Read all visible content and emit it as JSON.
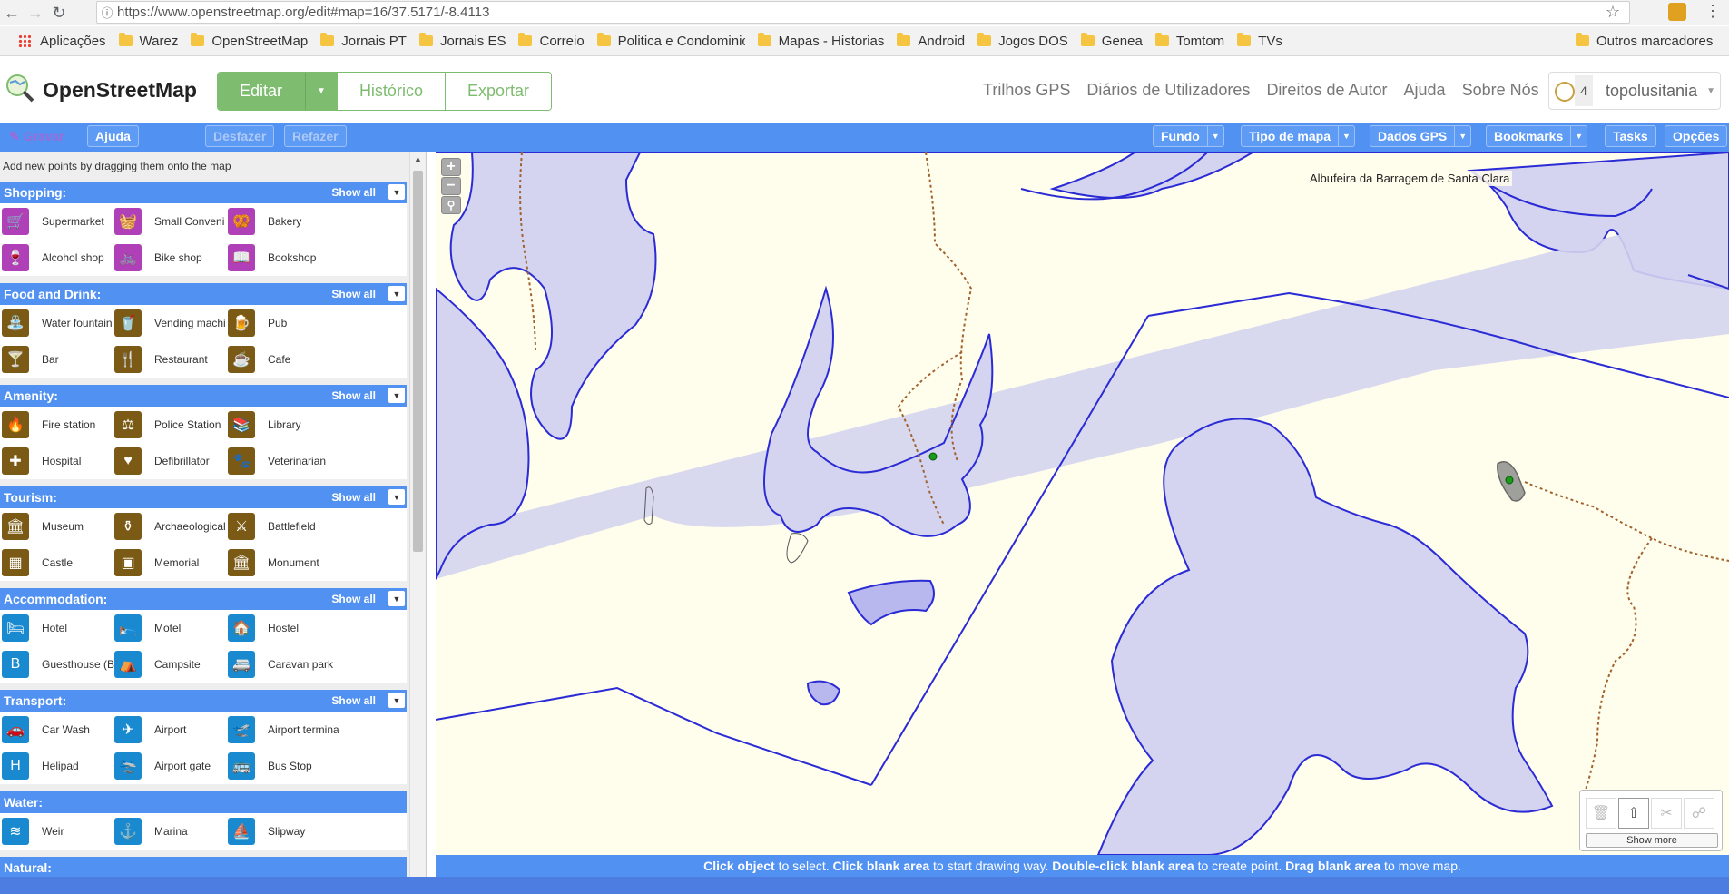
{
  "browser": {
    "url": "https://www.openstreetmap.org/edit#map=16/37.5171/-8.4113",
    "bookmarks": [
      "Aplicações",
      "Warez",
      "OpenStreetMap",
      "Jornais PT",
      "Jornais ES",
      "Correio",
      "Politica e Condominic",
      "Mapas - Historias",
      "Android",
      "Jogos DOS",
      "Genea",
      "Tomtom",
      "TVs"
    ],
    "other_bookmarks": "Outros marcadores"
  },
  "header": {
    "logo": "OpenStreetMap",
    "edit": "Editar",
    "history": "Histórico",
    "export": "Exportar",
    "links": [
      "Trilhos GPS",
      "Diários de Utilizadores",
      "Direitos de Autor",
      "Ajuda",
      "Sobre Nós"
    ],
    "user_count": "4",
    "user_name": "topolusitania"
  },
  "toolbar": {
    "save": "Gravar",
    "help": "Ajuda",
    "undo": "Desfazer",
    "redo": "Refazer",
    "background": "Fundo",
    "map_type": "Tipo de mapa",
    "gps_data": "Dados GPS",
    "bookmarks": "Bookmarks",
    "tasks": "Tasks",
    "options": "Opções"
  },
  "sidebar": {
    "hint": "Add new points by dragging them onto the map",
    "show_all": "Show all",
    "categories": [
      {
        "title": "Shopping:",
        "color": "#b040b8",
        "items": [
          "Supermarket",
          "Small Conveni",
          "Bakery",
          "Alcohol shop",
          "Bike shop",
          "Bookshop"
        ]
      },
      {
        "title": "Food and Drink:",
        "color": "#7a5a14",
        "items": [
          "Water fountain",
          "Vending machi",
          "Pub",
          "Bar",
          "Restaurant",
          "Cafe"
        ]
      },
      {
        "title": "Amenity:",
        "color": "#7a5a14",
        "items": [
          "Fire station",
          "Police Station",
          "Library",
          "Hospital",
          "Defibrillator",
          "Veterinarian"
        ]
      },
      {
        "title": "Tourism:",
        "color": "#7a5a14",
        "items": [
          "Museum",
          "Archaeological",
          "Battlefield",
          "Castle",
          "Memorial",
          "Monument"
        ]
      },
      {
        "title": "Accommodation:",
        "color": "#1a8ad0",
        "items": [
          "Hotel",
          "Motel",
          "Hostel",
          "Guesthouse (B",
          "Campsite",
          "Caravan park"
        ]
      },
      {
        "title": "Transport:",
        "color": "#1a8ad0",
        "items": [
          "Car Wash",
          "Airport",
          "Airport termina",
          "Helipad",
          "Airport gate",
          "Bus Stop"
        ]
      },
      {
        "title": "Water:",
        "color": "#1a8ad0",
        "items": [
          "Weir",
          "Marina",
          "Slipway"
        ]
      },
      {
        "title": "Natural:",
        "color": "#1a8ad0",
        "items": []
      }
    ]
  },
  "map": {
    "label": "Albufeira da Barragem de Santa Clara",
    "status_parts": [
      "Click object",
      " to select. ",
      "Click blank area",
      " to start drawing way. ",
      "Double-click blank area",
      " to create point. ",
      "Drag blank area",
      " to move map."
    ],
    "show_more": "Show more"
  }
}
